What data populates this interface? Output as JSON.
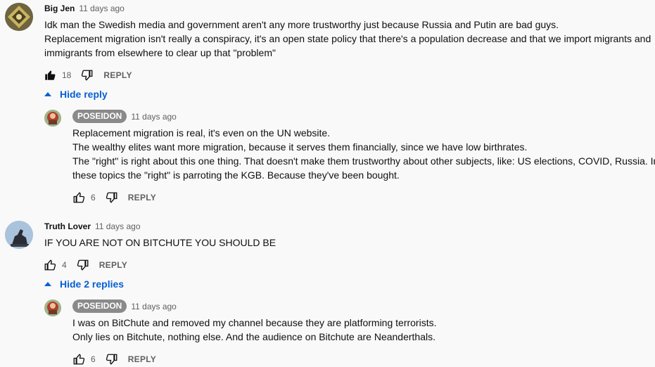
{
  "comments": [
    {
      "author": "Big Jen",
      "time": "11 days ago",
      "lines": [
        "Idk man the Swedish media and government aren't any more trustworthy just because Russia and Putin are bad guys.",
        "Replacement migration isn't really a conspiracy, it's an open state policy that there's a population decrease and that we import migrants and",
        "immigrants from elsewhere to clear up that \"problem\""
      ],
      "likes": "18",
      "reply_label": "REPLY",
      "toggle_label": "Hide reply"
    },
    {
      "author": "POSEIDON",
      "time": "11 days ago",
      "lines": [
        "Replacement migration is real, it's even on the UN website.",
        "The wealthy elites want more migration, because it serves them financially, since we have low birthrates.",
        "The \"right\" is right about this one thing. That doesn't make them trustworthy about other subjects, like: US elections, COVID, Russia. In",
        "these topics the \"right\" is parroting the KGB. Because they've been bought."
      ],
      "likes": "6",
      "reply_label": "REPLY"
    },
    {
      "author": "Truth Lover",
      "time": "11 days ago",
      "lines": [
        "IF YOU ARE NOT ON BITCHUTE YOU SHOULD BE"
      ],
      "likes": "4",
      "reply_label": "REPLY",
      "toggle_label": "Hide 2 replies"
    },
    {
      "author": "POSEIDON",
      "time": "11 days ago",
      "lines": [
        "I was on BitChute and removed my channel because they are platforming terrorists.",
        "Only lies on Bitchute, nothing else. And the audience on Bitchute are Neanderthals."
      ],
      "likes": "6",
      "reply_label": "REPLY"
    }
  ],
  "colors": {
    "link": "#065fd4",
    "badge": "#8a8a8a",
    "meta": "#606060"
  }
}
